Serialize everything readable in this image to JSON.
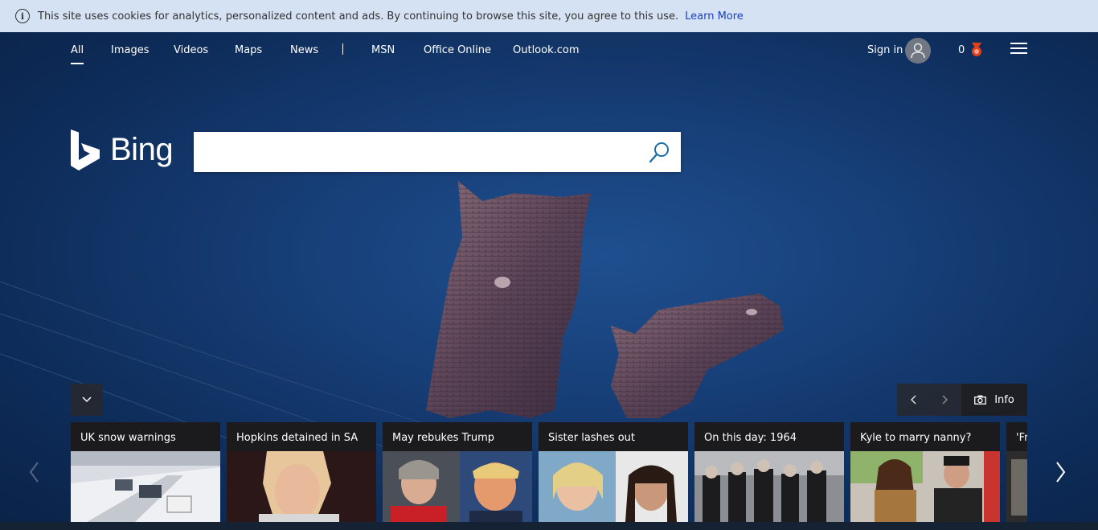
{
  "cookie_bar": {
    "message": "This site uses cookies for analytics, personalized content and ads. By continuing to browse this site, you agree to this use.",
    "learn_more": "Learn More",
    "icon": "info-icon"
  },
  "nav": {
    "items": [
      {
        "label": "All",
        "active": true
      },
      {
        "label": "Images"
      },
      {
        "label": "Videos"
      },
      {
        "label": "Maps"
      },
      {
        "label": "News"
      },
      {
        "label": "MSN"
      },
      {
        "label": "Office Online"
      },
      {
        "label": "Outlook.com"
      }
    ],
    "sign_in": "Sign in",
    "rewards_count": "0",
    "menu_icon": "hamburger-icon"
  },
  "logo": {
    "text": "Bing"
  },
  "search": {
    "placeholder": "",
    "value": ""
  },
  "image_controls": {
    "info_label": "Info",
    "icons": [
      "chevron-left-icon",
      "chevron-right-icon",
      "camera-icon"
    ]
  },
  "colors": {
    "cookie_bg": "#d5e2f3",
    "link": "#1a3fbf",
    "background": "#173f78",
    "card_bg": "#1b1b1d",
    "medal": "#e0401a"
  },
  "carousel": {
    "cards": [
      {
        "title": "UK snow warnings"
      },
      {
        "title": "Hopkins detained in SA"
      },
      {
        "title": "May rebukes Trump"
      },
      {
        "title": "Sister lashes out"
      },
      {
        "title": "On this day: 1964"
      },
      {
        "title": "Kyle to marry nanny?"
      },
      {
        "title": "'Fr"
      }
    ]
  }
}
